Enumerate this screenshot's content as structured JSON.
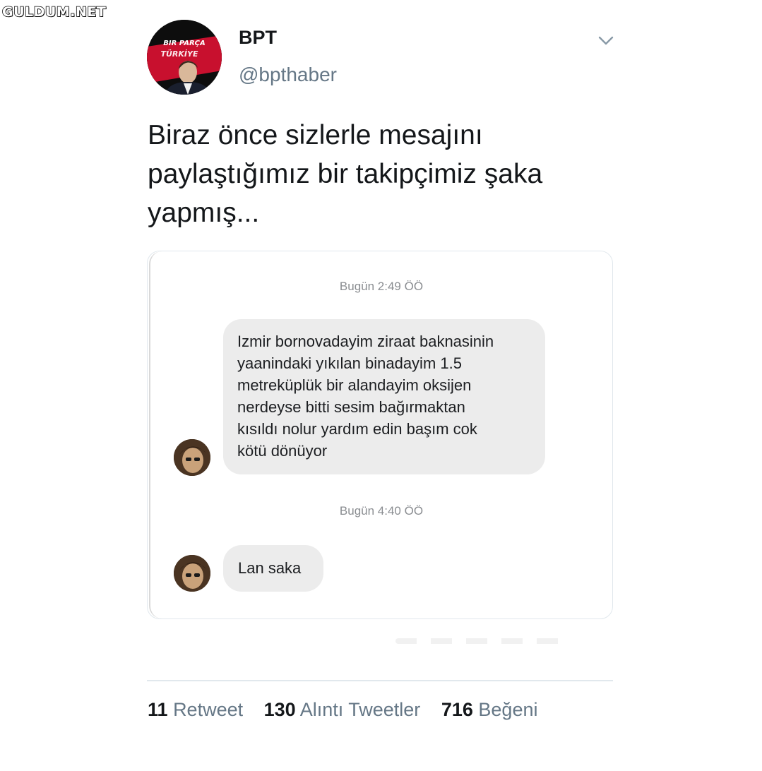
{
  "watermark": "GULDUM.NET",
  "tweet": {
    "display_name": "BPT",
    "handle": "@bpthaber",
    "avatar_text": [
      "BIR PARÇA",
      "TÜRKİYE"
    ],
    "text_lines": [
      "Biraz önce sizlerle mesajını",
      "paylaştığımız bir takipçimiz şaka",
      "yapmış..."
    ]
  },
  "chat": {
    "messages": [
      {
        "timestamp": "Bugün 2:49 ÖÖ",
        "lines": [
          "Izmir bornovadayim ziraat baknasinin",
          "yaanindaki yıkılan binadayim 1.5",
          "metreküplük bir alandayim oksijen",
          "nerdeyse bitti sesim bağırmaktan",
          "kısıldı nolur yardım edin başım cok",
          "kötü dönüyor"
        ]
      },
      {
        "timestamp": "Bugün 4:40 ÖÖ",
        "lines": [
          "Lan saka"
        ]
      }
    ]
  },
  "stats": {
    "retweets": {
      "count": "11",
      "label": "Retweet"
    },
    "quotes": {
      "count": "130",
      "label": "Alıntı Tweetler"
    },
    "likes": {
      "count": "716",
      "label": "Beğeni"
    }
  },
  "colors": {
    "secondary_text": "#657786",
    "bubble": "#ececec",
    "avatar_red": "#c8102e"
  },
  "icons": [
    "chevron-down-icon"
  ]
}
